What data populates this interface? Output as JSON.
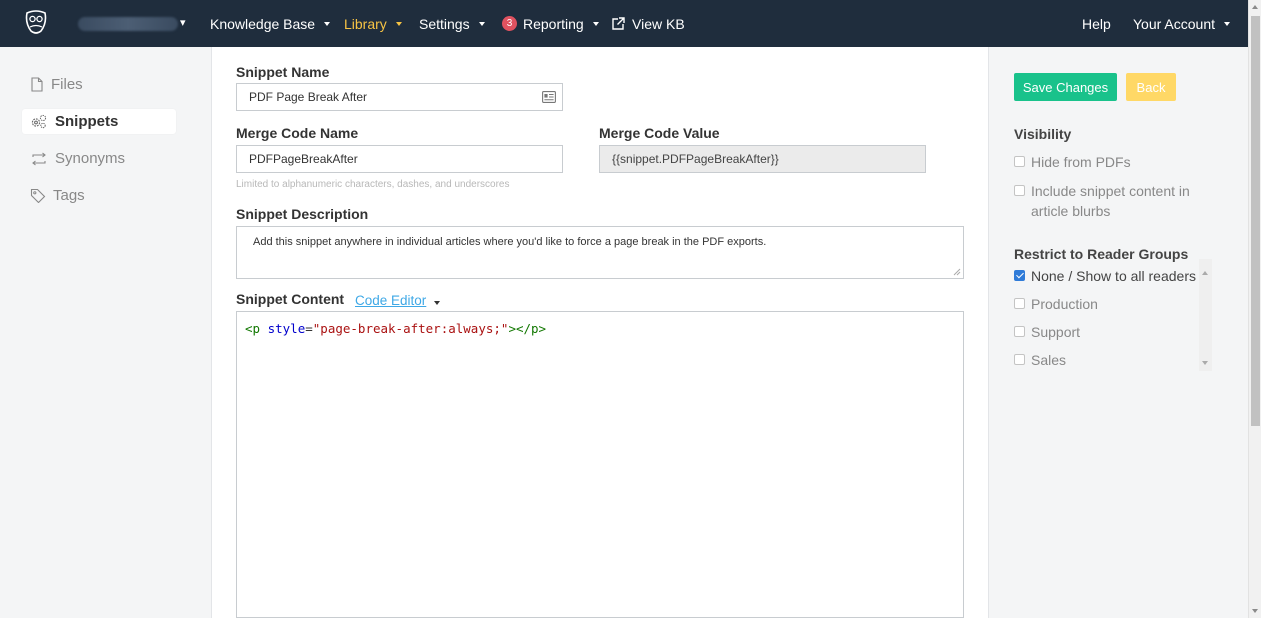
{
  "nav": {
    "brand_caret": "▾",
    "items": [
      {
        "label": "Knowledge Base",
        "active": false
      },
      {
        "label": "Library",
        "active": true
      },
      {
        "label": "Settings",
        "active": false
      }
    ],
    "reporting": {
      "badge": "3",
      "label": "Reporting"
    },
    "view_kb": "View KB",
    "help": "Help",
    "account": "Your Account"
  },
  "sidebar": {
    "items": [
      {
        "label": "Files",
        "icon": "file-icon",
        "active": false
      },
      {
        "label": "Snippets",
        "icon": "gears-icon",
        "active": true
      },
      {
        "label": "Synonyms",
        "icon": "repeat-icon",
        "active": false
      },
      {
        "label": "Tags",
        "icon": "tag-icon",
        "active": false
      }
    ]
  },
  "form": {
    "snippet_name_label": "Snippet Name",
    "snippet_name_value": "PDF Page Break After",
    "merge_code_name_label": "Merge Code Name",
    "merge_code_name_value": "PDFPageBreakAfter",
    "merge_code_hint": "Limited to alphanumeric characters, dashes, and underscores",
    "merge_code_value_label": "Merge Code Value",
    "merge_code_value": "{{snippet.PDFPageBreakAfter}}",
    "description_label": "Snippet Description",
    "description_value": "Add this snippet anywhere in individual articles where you'd like to force a page break in the PDF exports.",
    "content_label": "Snippet Content",
    "code_editor_link": "Code Editor",
    "code": {
      "open_tag": "<p",
      "attr_name": "style",
      "equals": "=",
      "attr_value": "\"page-break-after:always;\"",
      "close_open": ">",
      "close_tag": "</p>"
    }
  },
  "panel": {
    "save_label": "Save Changes",
    "back_label": "Back",
    "visibility_heading": "Visibility",
    "hide_pdfs": "Hide from PDFs",
    "include_blurbs": "Include snippet content in article blurbs",
    "restrict_heading": "Restrict to Reader Groups",
    "groups": [
      {
        "label": "None / Show to all readers",
        "checked": true
      },
      {
        "label": "Production",
        "checked": false
      },
      {
        "label": "Support",
        "checked": false
      },
      {
        "label": "Sales",
        "checked": false
      }
    ]
  },
  "colors": {
    "nav_bg": "#1f2d3d",
    "nav_active": "#f6c344",
    "save_green": "#19c28b",
    "back_yellow": "#ffd866",
    "link_blue": "#3ea8e6",
    "badge_red": "#e05260"
  }
}
